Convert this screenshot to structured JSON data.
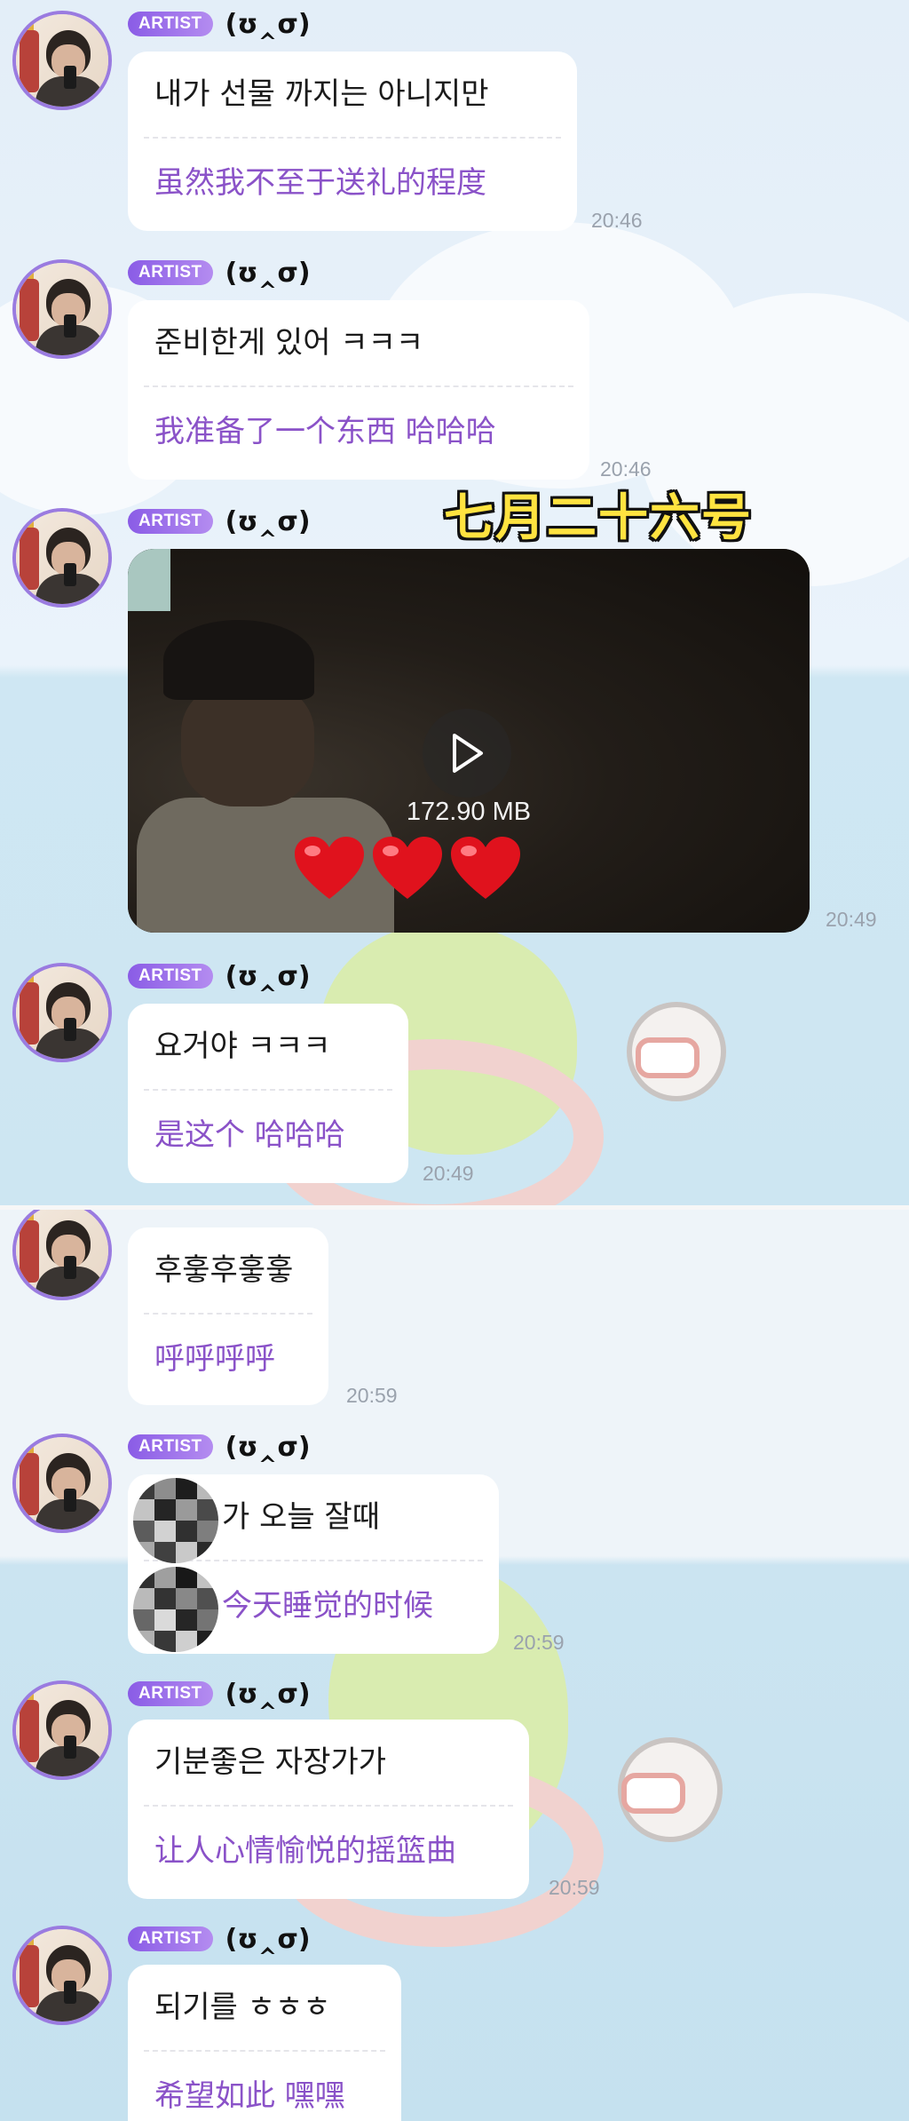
{
  "overlay_title": "七月二十六号",
  "artist_badge": "ARTIST",
  "nickname": "(ʊ‸σ)",
  "video": {
    "size_label": "172.90 MB"
  },
  "messages": [
    {
      "ko": "내가 선물 까지는 아니지만",
      "zh": "虽然我不至于送礼的程度",
      "time": "20:46"
    },
    {
      "ko": "준비한게 있어 ㅋㅋㅋ",
      "zh": "我准备了一个东西 哈哈哈",
      "time": "20:46"
    },
    {
      "video_time": "20:49"
    },
    {
      "ko": "요거야 ㅋㅋㅋ",
      "zh": "是这个 哈哈哈",
      "time": "20:49"
    },
    {
      "ko": "후훟후훟훟",
      "zh": "呼呼呼呼",
      "time": "20:59"
    },
    {
      "ko": "가 오늘 잘때",
      "zh": "今天睡觉的时候",
      "time": "20:59"
    },
    {
      "ko": "기분좋은 자장가가",
      "zh": "让人心情愉悦的摇篮曲",
      "time": "20:59"
    },
    {
      "ko": "되기를 ㅎㅎㅎ",
      "zh": "希望如此 嘿嘿",
      "time": ""
    }
  ],
  "colors": {
    "accent": "#8a52c8",
    "badge": "#9a6be8",
    "video_bg": "#17130f",
    "timestamp": "#9aa2ad"
  }
}
